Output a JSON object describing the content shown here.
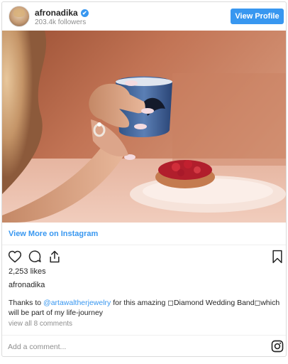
{
  "header": {
    "username": "afronadika",
    "verified_mark": "✔",
    "followers": "203.4k followers",
    "view_profile_label": "View Profile"
  },
  "photo": {
    "description_icon": "photo-image"
  },
  "links": {
    "view_more_label": "View More on Instagram"
  },
  "actions": {
    "like_icon": "heart-icon",
    "comment_icon": "comment-icon",
    "share_icon": "share-icon",
    "save_icon": "bookmark-icon"
  },
  "post": {
    "likes": "2,253 likes",
    "caption_user": "afronadika",
    "caption_prefix": "Thanks to ",
    "caption_mention": "@artawaltherjewelry",
    "caption_suffix": " for this amazing ◻Diamond Wedding Band◻which will be part of my life-journey",
    "view_all_comments": "view all 8 comments"
  },
  "comment": {
    "placeholder": "Add a comment..."
  },
  "colors": {
    "accent": "#3897f0",
    "text": "#262626",
    "muted": "#8e8e8e",
    "border": "#dbdbdb"
  }
}
